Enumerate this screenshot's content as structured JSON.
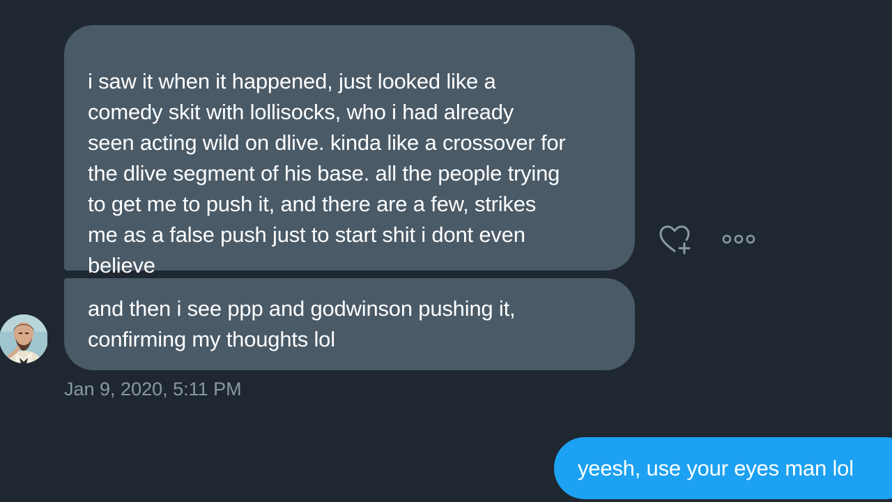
{
  "conversation": {
    "messages_in": [
      {
        "text": "i saw it when it happened, just looked like a\ncomedy skit with lollisocks, who i had already\nseen acting wild on dlive. kinda like a crossover for\nthe dlive segment of his base. all the people trying\nto get me to push it, and there are a few, strikes\nme as a false push just to start shit i dont even\nbelieve"
      },
      {
        "text": "and then i see ppp and godwinson pushing it,\nconfirming my thoughts lol"
      }
    ],
    "timestamp": "Jan 9, 2020, 5:11 PM",
    "message_out": {
      "text": "yeesh, use your eyes man lol"
    },
    "actions": {
      "like_icon": "heart-plus-icon",
      "more_icon": "more-horizontal-icon"
    }
  },
  "colors": {
    "background": "#1f2731",
    "incoming_bubble": "#4a5a67",
    "outgoing_bubble": "#1da1f2",
    "timestamp": "#8899a6",
    "icon": "#8899a6"
  }
}
